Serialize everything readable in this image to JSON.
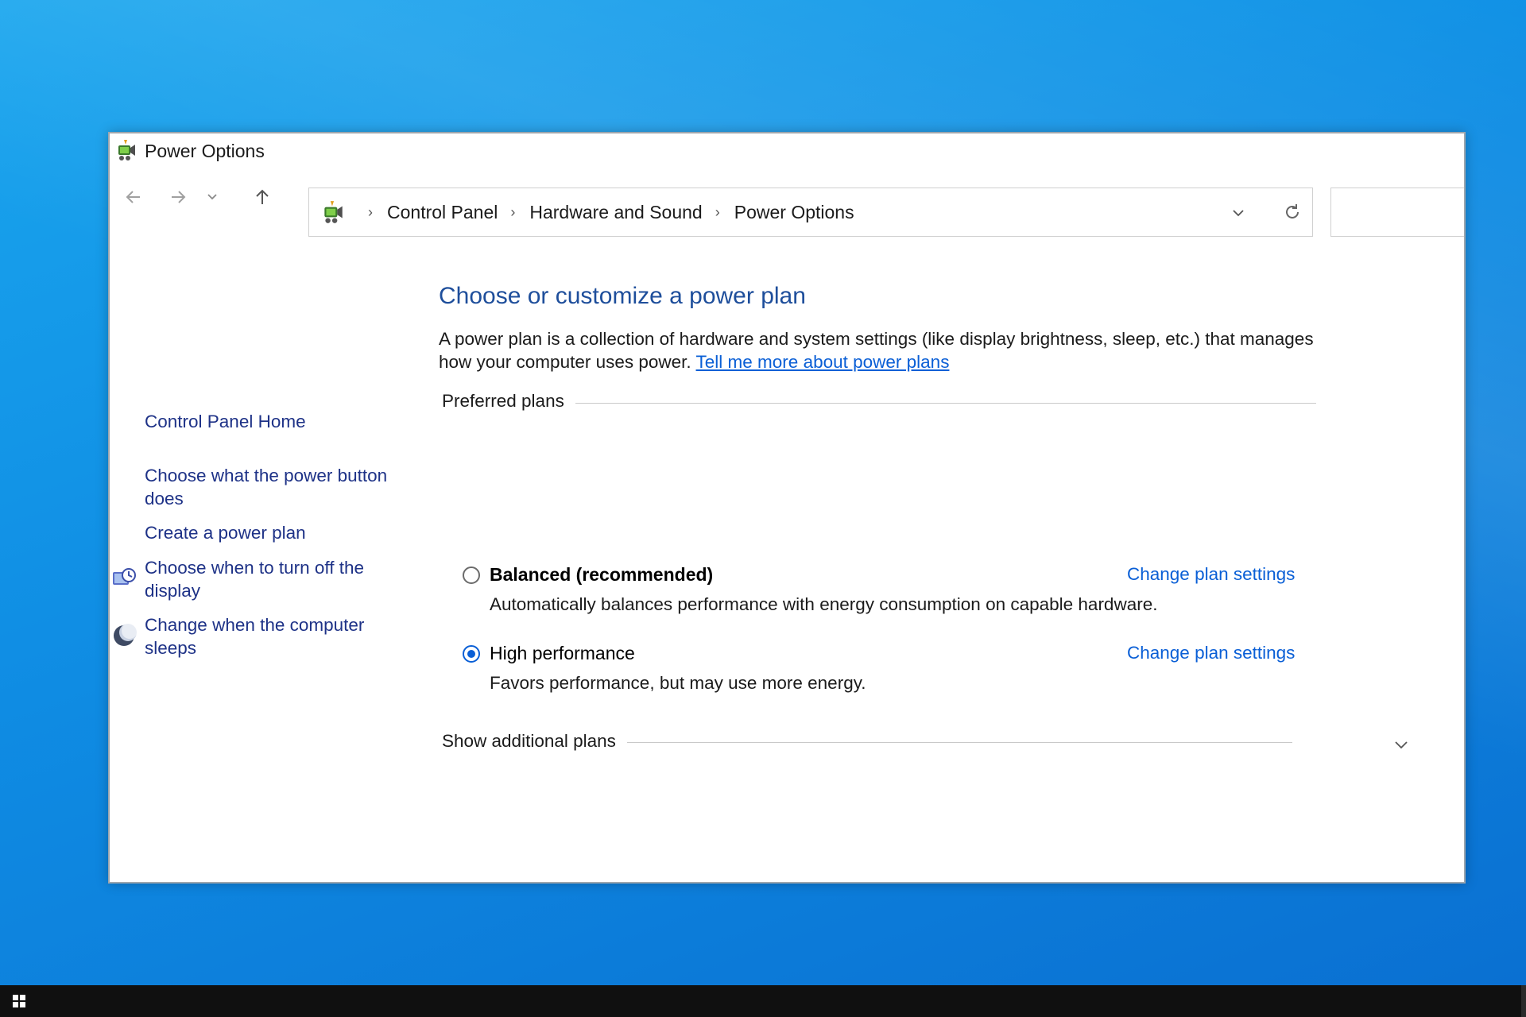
{
  "window": {
    "title": "Power Options"
  },
  "address_bar": {
    "crumbs": [
      "Control Panel",
      "Hardware and Sound",
      "Power Options"
    ],
    "separator": "›",
    "search_placeholder": ""
  },
  "sidebar": {
    "items": [
      {
        "label": "Control Panel Home"
      },
      {
        "label": "Choose what the power button does"
      },
      {
        "label": "Create a power plan"
      },
      {
        "label": "Choose when to turn off the display"
      },
      {
        "label": "Change when the computer sleeps"
      }
    ]
  },
  "main": {
    "heading": "Choose or customize a power plan",
    "description": "A power plan is a collection of hardware and system settings (like display brightness, sleep, etc.) that manages how your computer uses power.",
    "learn_more_link": "Tell me more about power plans",
    "preferred_label": "Preferred plans",
    "plans": [
      {
        "name": "Balanced (recommended)",
        "description": "Automatically balances performance with energy consumption on capable hardware.",
        "link": "Change plan settings",
        "selected": false
      },
      {
        "name": "High performance",
        "description": "Favors performance, but may use more energy.",
        "link": "Change plan settings",
        "selected": true
      }
    ],
    "additional_label": "Show additional plans"
  },
  "colors": {
    "accent": "#0a5fd6",
    "sidebar_link": "#1e3287",
    "heading": "#1e4e9b",
    "desktop": "#0f8ce3",
    "taskbar": "#101010"
  },
  "icons": {
    "app": "power-options-icon",
    "back": "arrow-left-icon",
    "forward": "arrow-right-icon",
    "recent": "chevron-down-icon",
    "up": "arrow-up-icon",
    "refresh": "refresh-icon",
    "display": "display-timer-icon",
    "sleep": "moon-icon",
    "start": "windows-logo-icon"
  }
}
